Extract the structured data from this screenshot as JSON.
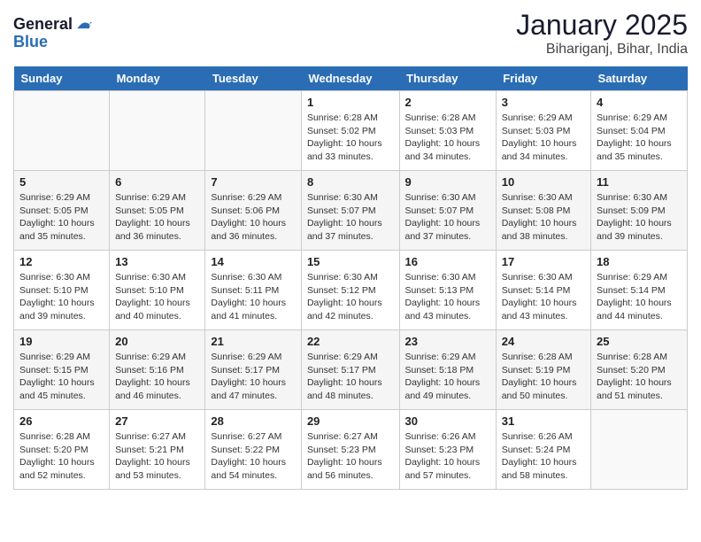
{
  "header": {
    "logo_line1": "General",
    "logo_line2": "Blue",
    "month": "January 2025",
    "location": "Bihariganj, Bihar, India"
  },
  "weekdays": [
    "Sunday",
    "Monday",
    "Tuesday",
    "Wednesday",
    "Thursday",
    "Friday",
    "Saturday"
  ],
  "weeks": [
    [
      {
        "day": "",
        "info": ""
      },
      {
        "day": "",
        "info": ""
      },
      {
        "day": "",
        "info": ""
      },
      {
        "day": "1",
        "info": "Sunrise: 6:28 AM\nSunset: 5:02 PM\nDaylight: 10 hours\nand 33 minutes."
      },
      {
        "day": "2",
        "info": "Sunrise: 6:28 AM\nSunset: 5:03 PM\nDaylight: 10 hours\nand 34 minutes."
      },
      {
        "day": "3",
        "info": "Sunrise: 6:29 AM\nSunset: 5:03 PM\nDaylight: 10 hours\nand 34 minutes."
      },
      {
        "day": "4",
        "info": "Sunrise: 6:29 AM\nSunset: 5:04 PM\nDaylight: 10 hours\nand 35 minutes."
      }
    ],
    [
      {
        "day": "5",
        "info": "Sunrise: 6:29 AM\nSunset: 5:05 PM\nDaylight: 10 hours\nand 35 minutes."
      },
      {
        "day": "6",
        "info": "Sunrise: 6:29 AM\nSunset: 5:05 PM\nDaylight: 10 hours\nand 36 minutes."
      },
      {
        "day": "7",
        "info": "Sunrise: 6:29 AM\nSunset: 5:06 PM\nDaylight: 10 hours\nand 36 minutes."
      },
      {
        "day": "8",
        "info": "Sunrise: 6:30 AM\nSunset: 5:07 PM\nDaylight: 10 hours\nand 37 minutes."
      },
      {
        "day": "9",
        "info": "Sunrise: 6:30 AM\nSunset: 5:07 PM\nDaylight: 10 hours\nand 37 minutes."
      },
      {
        "day": "10",
        "info": "Sunrise: 6:30 AM\nSunset: 5:08 PM\nDaylight: 10 hours\nand 38 minutes."
      },
      {
        "day": "11",
        "info": "Sunrise: 6:30 AM\nSunset: 5:09 PM\nDaylight: 10 hours\nand 39 minutes."
      }
    ],
    [
      {
        "day": "12",
        "info": "Sunrise: 6:30 AM\nSunset: 5:10 PM\nDaylight: 10 hours\nand 39 minutes."
      },
      {
        "day": "13",
        "info": "Sunrise: 6:30 AM\nSunset: 5:10 PM\nDaylight: 10 hours\nand 40 minutes."
      },
      {
        "day": "14",
        "info": "Sunrise: 6:30 AM\nSunset: 5:11 PM\nDaylight: 10 hours\nand 41 minutes."
      },
      {
        "day": "15",
        "info": "Sunrise: 6:30 AM\nSunset: 5:12 PM\nDaylight: 10 hours\nand 42 minutes."
      },
      {
        "day": "16",
        "info": "Sunrise: 6:30 AM\nSunset: 5:13 PM\nDaylight: 10 hours\nand 43 minutes."
      },
      {
        "day": "17",
        "info": "Sunrise: 6:30 AM\nSunset: 5:14 PM\nDaylight: 10 hours\nand 43 minutes."
      },
      {
        "day": "18",
        "info": "Sunrise: 6:29 AM\nSunset: 5:14 PM\nDaylight: 10 hours\nand 44 minutes."
      }
    ],
    [
      {
        "day": "19",
        "info": "Sunrise: 6:29 AM\nSunset: 5:15 PM\nDaylight: 10 hours\nand 45 minutes."
      },
      {
        "day": "20",
        "info": "Sunrise: 6:29 AM\nSunset: 5:16 PM\nDaylight: 10 hours\nand 46 minutes."
      },
      {
        "day": "21",
        "info": "Sunrise: 6:29 AM\nSunset: 5:17 PM\nDaylight: 10 hours\nand 47 minutes."
      },
      {
        "day": "22",
        "info": "Sunrise: 6:29 AM\nSunset: 5:17 PM\nDaylight: 10 hours\nand 48 minutes."
      },
      {
        "day": "23",
        "info": "Sunrise: 6:29 AM\nSunset: 5:18 PM\nDaylight: 10 hours\nand 49 minutes."
      },
      {
        "day": "24",
        "info": "Sunrise: 6:28 AM\nSunset: 5:19 PM\nDaylight: 10 hours\nand 50 minutes."
      },
      {
        "day": "25",
        "info": "Sunrise: 6:28 AM\nSunset: 5:20 PM\nDaylight: 10 hours\nand 51 minutes."
      }
    ],
    [
      {
        "day": "26",
        "info": "Sunrise: 6:28 AM\nSunset: 5:20 PM\nDaylight: 10 hours\nand 52 minutes."
      },
      {
        "day": "27",
        "info": "Sunrise: 6:27 AM\nSunset: 5:21 PM\nDaylight: 10 hours\nand 53 minutes."
      },
      {
        "day": "28",
        "info": "Sunrise: 6:27 AM\nSunset: 5:22 PM\nDaylight: 10 hours\nand 54 minutes."
      },
      {
        "day": "29",
        "info": "Sunrise: 6:27 AM\nSunset: 5:23 PM\nDaylight: 10 hours\nand 56 minutes."
      },
      {
        "day": "30",
        "info": "Sunrise: 6:26 AM\nSunset: 5:23 PM\nDaylight: 10 hours\nand 57 minutes."
      },
      {
        "day": "31",
        "info": "Sunrise: 6:26 AM\nSunset: 5:24 PM\nDaylight: 10 hours\nand 58 minutes."
      },
      {
        "day": "",
        "info": ""
      }
    ]
  ]
}
